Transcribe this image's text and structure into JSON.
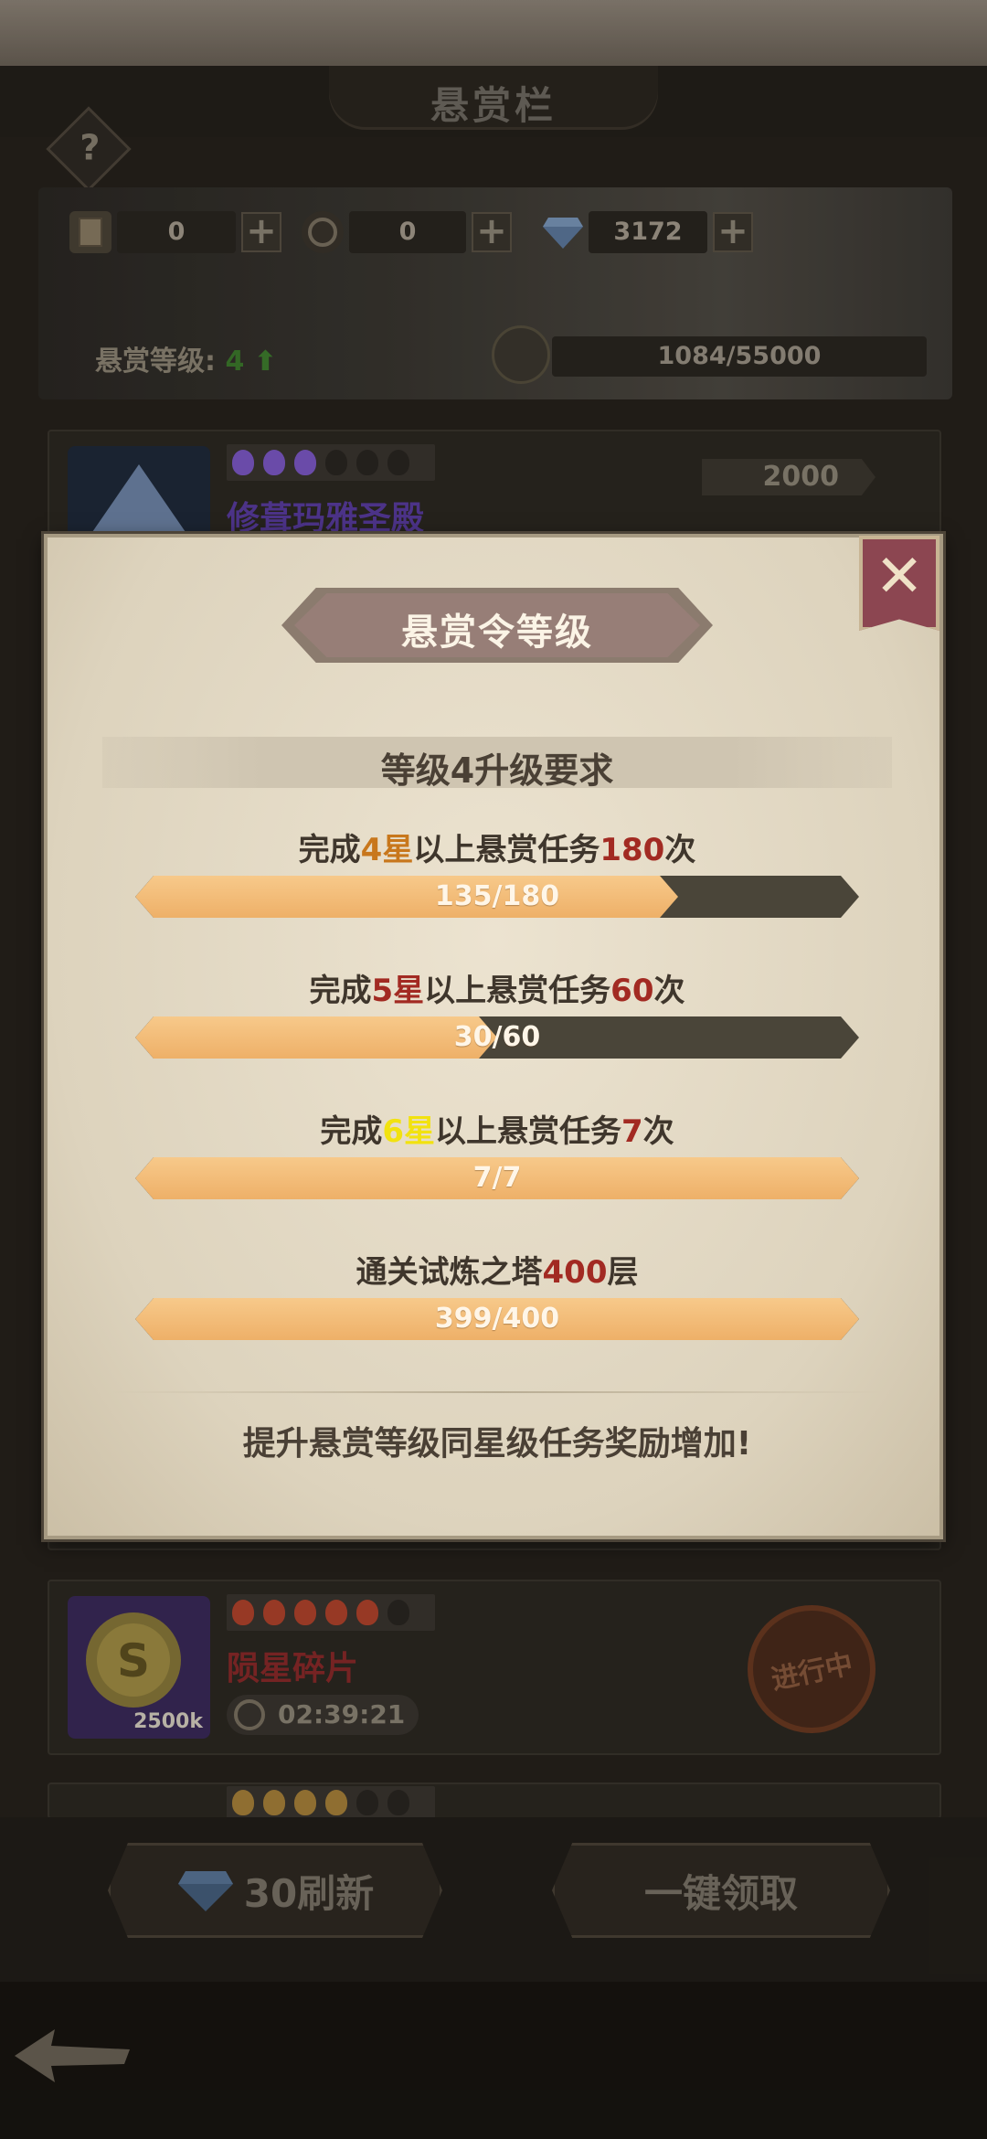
{
  "header": {
    "title": "悬赏栏",
    "help_glyph": "?",
    "resources": [
      {
        "icon": "bounty-scroll-icon",
        "value": "0"
      },
      {
        "icon": "medal-icon",
        "value": "0"
      },
      {
        "icon": "diamond-icon",
        "value": "3172"
      }
    ],
    "plus_glyph": "+",
    "level_label": "悬赏等级:",
    "level_value": "4",
    "level_up_glyph": "⬆",
    "exp_text": "1084/55000"
  },
  "list": {
    "cards": [
      {
        "name": "修葺玛雅圣殿",
        "reward": "2000",
        "stars": 3
      },
      {
        "name": "陨星碎片",
        "thumb_label": "2500k",
        "timer": "02:39:21",
        "status": "进行中",
        "stars": 5
      }
    ]
  },
  "bottom": {
    "refresh_label": "30刷新",
    "claim_all_label": "一键领取"
  },
  "modal": {
    "title": "悬赏令等级",
    "close_glyph": "✕",
    "section_title": "等级4升级要求",
    "requirements": [
      {
        "pre": "完成",
        "star": "4星",
        "mid": "以上悬赏任务",
        "count": "180",
        "post": "次",
        "progress_text": "135/180",
        "progress": 0.75
      },
      {
        "pre": "完成",
        "star": "5星",
        "mid": "以上悬赏任务",
        "count": "60",
        "post": "次",
        "progress_text": "30/60",
        "progress": 0.5
      },
      {
        "pre": "完成",
        "star": "6星",
        "mid": "以上悬赏任务",
        "count": "7",
        "post": "次",
        "progress_text": "7/7",
        "progress": 1.0
      },
      {
        "pre": "通关试炼之塔",
        "star": "",
        "mid": "",
        "count": "400",
        "post": "层",
        "progress_text": "399/400",
        "progress": 1.0
      }
    ],
    "footnote": "提升悬赏等级同星级任务奖励增加!"
  },
  "colors": {
    "star4": "#c8771c",
    "star5": "#a22a22",
    "star6": "#f2e20f",
    "count": "#a22a22",
    "purple_name": "#5a3ca0",
    "red_name": "#8a2a2a"
  }
}
